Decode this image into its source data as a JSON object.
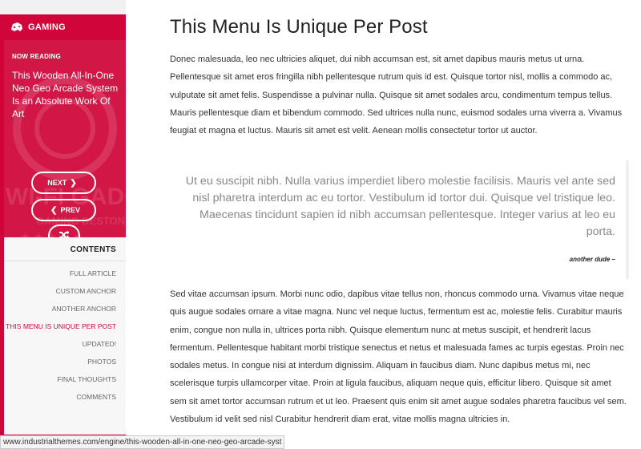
{
  "sidebar": {
    "category": {
      "icon": "gamepad-icon",
      "label": "GAMING"
    },
    "now_reading": {
      "label": "NOW READING",
      "title": "This Wooden All-In-One Neo Geo Arcade System Is an Absolute Work Of Art"
    },
    "buttons": {
      "next": "NEXT",
      "prev": "PREV",
      "shuffle_icon": "shuffle-icon"
    },
    "contents": {
      "title": "CONTENTS",
      "items": [
        {
          "label": "FULL ARTICLE",
          "active": false
        },
        {
          "label": "CUSTOM ANCHOR",
          "active": false
        },
        {
          "label": "ANOTHER ANCHOR",
          "active": false
        },
        {
          "label": "THIS MENU IS UNIQUE PER POST",
          "active": true
        },
        {
          "label": "UPDATED!",
          "active": false
        },
        {
          "label": "PHOTOS",
          "active": false
        },
        {
          "label": "FINAL THOUGHTS",
          "active": false
        },
        {
          "label": "COMMENTS",
          "active": false
        }
      ]
    }
  },
  "article": {
    "heading": "This Menu Is Unique Per Post",
    "paragraph1": "Donec malesuada, leo nec ultricies aliquet, dui nibh accumsan est, sit amet dapibus mauris metus ut urna. Pellentesque sit amet eros fringilla nibh pellentesque rutrum quis id est. Quisque tortor nisl, mollis a commodo ac, vulputate sit amet felis. Suspendisse a pulvinar nulla. Quisque sit amet sodales arcu, condimentum tempus tellus. Mauris pellentesque diam et bibendum commodo. Sed ultrices nulla nunc, euismod sodales urna viverra a. Vivamus feugiat et magna et luctus. Mauris sit amet est velit. Aenean mollis consectetur tortor ut auctor.",
    "blockquote": "Ut eu suscipit nibh. Nulla varius imperdiet libero molestie facilisis. Mauris vel ante sed nisl pharetra interdum ac eu tortor. Vestibulum id tortor dui. Quisque vel tristique leo. Maecenas tincidunt sapien id nibh accumsan pellentesque. Integer varius at leo eu porta.",
    "citation": "another dude –",
    "paragraph2": "Sed vitae accumsan ipsum. Morbi nunc odio, dapibus vitae tellus non, rhoncus commodo urna. Vivamus vitae neque quis augue sodales ornare a vitae magna. Nunc vel neque luctus, fermentum est ac, molestie felis. Curabitur mauris enim, congue non nulla in, ultrices porta nibh. Quisque elementum nunc at metus suscipit, et hendrerit lacus fermentum. Pellentesque habitant morbi tristique senectus et netus et malesuada fames ac turpis egestas. Proin nec sodales metus. In congue nisi at interdum dignissim. Aliquam in faucibus diam. Nunc dapibus metus mi, nec scelerisque turpis ullamcorper vitae. Proin at ligula faucibus, aliquam neque quis, efficitur libero. Quisque sit amet sem sit amet tortor accumsan rutrum et ut leo. Praesent quis enim sit amet augue sodales pharetra faucibus vel sem. Vestibulum id velit sed nisl Curabitur hendrerit diam erat, vitae mollis magna ultricies in."
  },
  "statusbar": {
    "url": "www.industrialthemes.com/engine/this-wooden-all-in-one-neo-geo-arcade-syst"
  },
  "colors": {
    "brand_red": "#d0063a",
    "active_toc": "#d0063a"
  }
}
